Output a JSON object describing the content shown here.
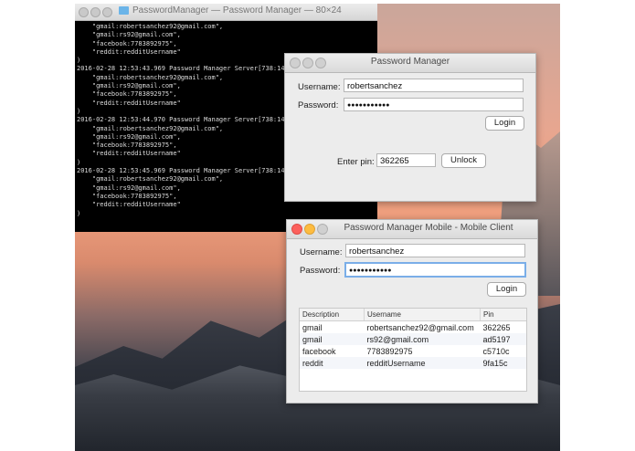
{
  "terminal": {
    "title": "PasswordManager — Password Manager — 80×24",
    "lines": [
      "    \"gmail:robertsanchez92@gmail.com\",",
      "    \"gmail:rs92@gmail.com\",",
      "    \"facebook:7783892975\",",
      "    \"reddit:redditUsername\"",
      ")",
      "2016-02-28 12:53:43.969 Password Manager Server[738:1478",
      "    \"gmail:robertsanchez92@gmail.com\",",
      "    \"gmail:rs92@gmail.com\",",
      "    \"facebook:7783892975\",",
      "    \"reddit:redditUsername\"",
      ")",
      "2016-02-28 12:53:44.970 Password Manager Server[738:1478",
      "    \"gmail:robertsanchez92@gmail.com\",",
      "    \"gmail:rs92@gmail.com\",",
      "    \"facebook:7783892975\",",
      "    \"reddit:redditUsername\"",
      ")",
      "2016-02-28 12:53:45.969 Password Manager Server[738:1478",
      "    \"gmail:robertsanchez92@gmail.com\",",
      "    \"gmail:rs92@gmail.com\",",
      "    \"facebook:7783892975\",",
      "    \"reddit:redditUsername\"",
      ")"
    ]
  },
  "server_window": {
    "title": "Password Manager",
    "username_label": "Username:",
    "username_value": "robertsanchez",
    "password_label": "Password:",
    "password_value": "●●●●●●●●●●●",
    "login_label": "Login",
    "pin_label": "Enter pin:",
    "pin_value": "362265",
    "unlock_label": "Unlock"
  },
  "mobile_window": {
    "title": "Password Manager Mobile - Mobile Client",
    "username_label": "Username:",
    "username_value": "robertsanchez",
    "password_label": "Password:",
    "password_value": "●●●●●●●●●●●",
    "login_label": "Login",
    "table": {
      "columns": [
        "Description",
        "Username",
        "Pin"
      ],
      "rows": [
        [
          "gmail",
          "robertsanchez92@gmail.com",
          "362265"
        ],
        [
          "gmail",
          "rs92@gmail.com",
          "ad5197"
        ],
        [
          "facebook",
          "7783892975",
          "c5710c"
        ],
        [
          "reddit",
          "redditUsername",
          "9fa15c"
        ]
      ]
    }
  },
  "colors": {
    "close": "#fc605c",
    "minimize": "#fdbc40",
    "zoom": "#c8c8c8",
    "focus_ring": "#7aaee8"
  }
}
